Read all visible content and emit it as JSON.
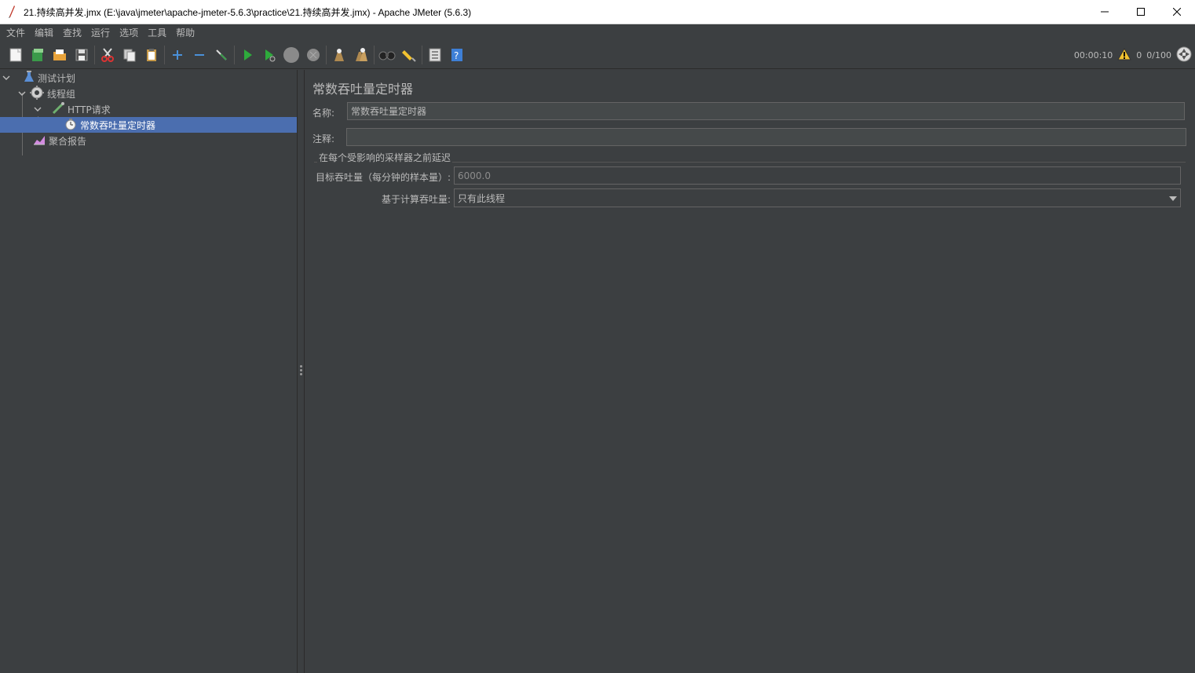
{
  "window": {
    "title": "21.持续高并发.jmx (E:\\java\\jmeter\\apache-jmeter-5.6.3\\practice\\21.持续高并发.jmx) - Apache JMeter (5.6.3)"
  },
  "menu": {
    "items": [
      "文件",
      "编辑",
      "查找",
      "运行",
      "选项",
      "工具",
      "帮助"
    ]
  },
  "toolbar": {
    "elapsed": "00:00:10",
    "warnings": "0",
    "threads": "0/100",
    "icons": [
      "new-icon",
      "templates-icon",
      "open-icon",
      "save-icon",
      "cut-icon",
      "copy-icon",
      "paste-icon",
      "expand-icon",
      "collapse-icon",
      "toggle-icon",
      "start-icon",
      "start-no-timers-icon",
      "stop-icon",
      "shutdown-icon",
      "clear-icon",
      "clear-all-icon",
      "search-icon",
      "reset-search-icon",
      "function-helper-icon",
      "help-icon"
    ]
  },
  "tree": {
    "items": [
      {
        "label": "测试计划"
      },
      {
        "label": "线程组"
      },
      {
        "label": "HTTP请求"
      },
      {
        "label": "常数吞吐量定时器"
      },
      {
        "label": "聚合报告"
      }
    ]
  },
  "panel": {
    "title": "常数吞吐量定时器",
    "name_label": "名称:",
    "name_value": "常数吞吐量定时器",
    "comment_label": "注释:",
    "comment_value": "",
    "group_title": "在每个受影响的采样器之前延迟",
    "throughput_label": "目标吞吐量（每分钟的样本量）:",
    "throughput_value": "6000.0",
    "calc_label": "基于计算吞吐量:",
    "calc_value": "只有此线程"
  },
  "colors": {
    "background": "#3c3f41",
    "selection": "#4b6eaf",
    "text": "#bbbbbb"
  }
}
